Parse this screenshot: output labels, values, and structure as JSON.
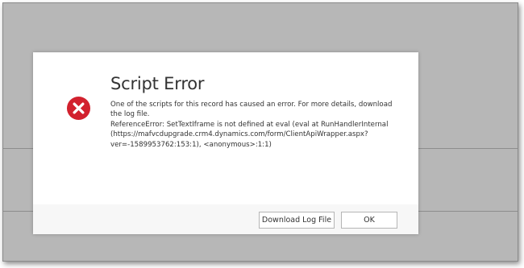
{
  "dialog": {
    "title": "Script Error",
    "message_lines": [
      "One of the scripts for this record has caused an error. For more details, download the log file.",
      "ReferenceError: SetTextIframe is not defined at eval (eval at RunHandlerInternal (https://mafvcdupgrade.crm4.dynamics.com/form/ClientApiWrapper.aspx?ver=-1589953762:153:1), <anonymous>:1:1)"
    ],
    "icon": "error-circle-x-icon",
    "icon_color": "#d2212e",
    "buttons": {
      "download_log_file": "Download Log File",
      "ok": "OK"
    }
  },
  "colors": {
    "overlay_background": "#b7b7b7",
    "dialog_background": "#ffffff",
    "footer_background": "#f7f7f7",
    "text": "#333333"
  }
}
